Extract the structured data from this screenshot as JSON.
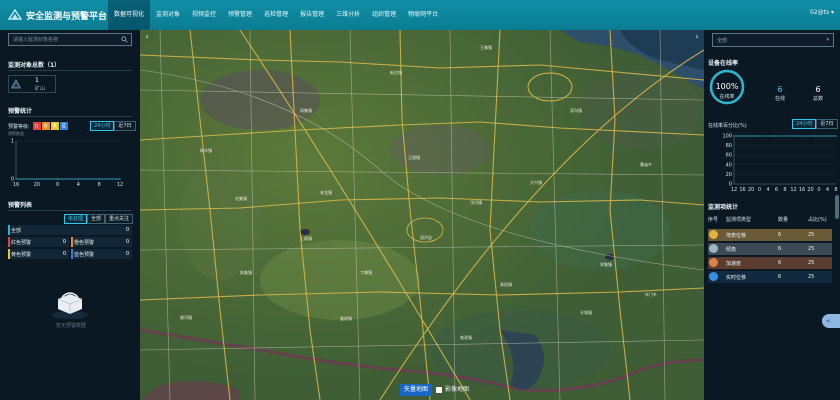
{
  "header": {
    "title": "安全监测与预警平台",
    "nav": [
      {
        "label": "数据可视化",
        "active": true
      },
      {
        "label": "监测对象",
        "active": false
      },
      {
        "label": "视频监控",
        "active": false
      },
      {
        "label": "预警管理",
        "active": false
      },
      {
        "label": "巡检管理",
        "active": false
      },
      {
        "label": "报告管理",
        "active": false
      },
      {
        "label": "三维分析",
        "active": false
      },
      {
        "label": "组织管理",
        "active": false
      },
      {
        "label": "物联网平台",
        "active": false
      }
    ],
    "user": "02@ts ▾"
  },
  "left": {
    "search_placeholder": "请输入监测对象名称",
    "objects_title": "监测对象总数（1）",
    "object_stat": {
      "value": "1",
      "label": "矿山"
    },
    "warning_stats_title": "预警统计",
    "level_label": "预警等级:",
    "level_swatches": [
      {
        "label": "红",
        "color": "#e0413a"
      },
      {
        "label": "橙",
        "color": "#f28a1f"
      },
      {
        "label": "黄",
        "color": "#e8c928"
      },
      {
        "label": "蓝",
        "color": "#2f7fe0"
      }
    ],
    "time_filters": [
      "24小时",
      "近7日"
    ],
    "chart_ylabel": "预警数量",
    "warning_list_title": "预警列表",
    "list_filters": [
      "未处理",
      "全部",
      "重点关注"
    ],
    "list_items": [
      {
        "label": "全部",
        "count": "0",
        "color": "#2bb4d6"
      },
      {
        "label": "红色预警",
        "count": "0",
        "color": "#e0413a"
      },
      {
        "label": "橙色预警",
        "count": "0",
        "color": "#f28a1f"
      },
      {
        "label": "黄色预警",
        "count": "0",
        "color": "#e8c928"
      },
      {
        "label": "蓝色预警",
        "count": "0",
        "color": "#2f7fe0"
      }
    ],
    "empty_text": "暂无预警数据"
  },
  "map": {
    "layer_vector": "矢量地图",
    "layer_image": "影像地图",
    "place_labels": [
      "王集镇",
      "新庄镇",
      "双沟镇",
      "周集镇",
      "耿车镇",
      "王楼镇",
      "大兴镇",
      "洋河镇",
      "仓集镇",
      "来龙镇",
      "丁嘴镇",
      "陆集镇",
      "泗洪县",
      "上塘镇",
      "重岗镇",
      "青阳镇",
      "半城镇",
      "临淮镇",
      "顺河镇",
      "界集镇",
      "曹庙乡",
      "车门乡"
    ]
  },
  "right": {
    "select_value": "全部",
    "online_title": "设备在线率",
    "online_rate": "100%",
    "online_rate_label": "在线率",
    "online_count": "6",
    "online_label": "在线",
    "total_count": "6",
    "total_label": "总数",
    "rate_chart_label": "在线率百分比(%)",
    "time_filters": [
      "24小时",
      "近7日"
    ],
    "device_stats_title": "监测项统计",
    "table_headers": [
      "序号",
      "监测项类型",
      "数量",
      "占比(%)"
    ],
    "table_rows": [
      {
        "type": "地表位移",
        "count": "6",
        "ratio": "25",
        "icon": "#e3b23c"
      },
      {
        "type": "倾角",
        "count": "6",
        "ratio": "25",
        "icon": "#9bb6c8"
      },
      {
        "type": "加速度",
        "count": "6",
        "ratio": "25",
        "icon": "#d9824a"
      },
      {
        "type": "实时位移",
        "count": "6",
        "ratio": "25",
        "icon": "#3a8fe0"
      }
    ]
  },
  "chart_data": [
    {
      "type": "line",
      "title": "",
      "ylabel": "预警数量",
      "x": [
        "16",
        "20",
        "0",
        "4",
        "8",
        "12"
      ],
      "series": [
        {
          "values": [
            0,
            0,
            0,
            0,
            0,
            0
          ]
        }
      ],
      "ylim": [
        0,
        1
      ],
      "yticks": [
        "0",
        "1"
      ]
    },
    {
      "type": "line",
      "title": "",
      "ylabel": "在线率百分比(%)",
      "x": [
        "12",
        "16",
        "20",
        "0",
        "4",
        "8"
      ],
      "x_display": [
        "12",
        "16",
        "20",
        "0",
        "4",
        "6",
        "8",
        "12",
        "16",
        "20",
        "0",
        "4",
        "8"
      ],
      "series": [
        {
          "values": [
            100,
            100,
            100,
            100,
            100,
            100
          ]
        }
      ],
      "ylim": [
        0,
        100
      ],
      "yticks": [
        "0",
        "20",
        "40",
        "60",
        "80",
        "100"
      ]
    }
  ]
}
